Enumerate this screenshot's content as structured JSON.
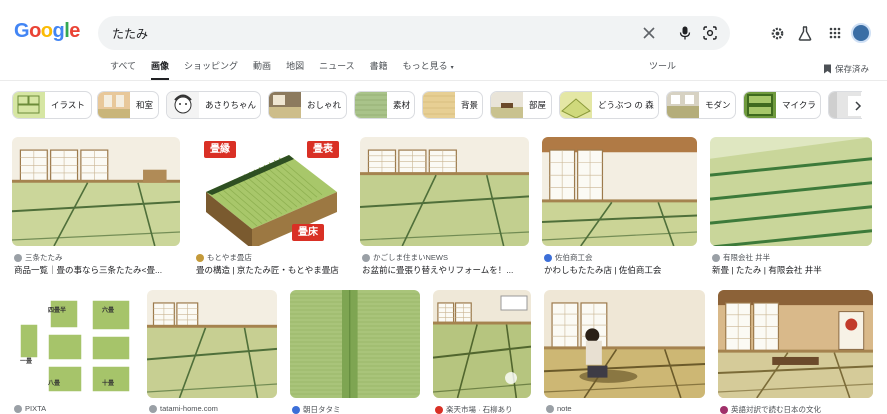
{
  "logo": {
    "text": "Google",
    "letters": [
      {
        "ch": "G",
        "color": "#4285f4"
      },
      {
        "ch": "o",
        "color": "#ea4335"
      },
      {
        "ch": "o",
        "color": "#fbbc05"
      },
      {
        "ch": "g",
        "color": "#4285f4"
      },
      {
        "ch": "l",
        "color": "#34a853"
      },
      {
        "ch": "e",
        "color": "#ea4335"
      }
    ]
  },
  "search": {
    "value": "たたみ"
  },
  "header_icons": [
    "clear-icon",
    "microphone-icon",
    "lens-icon",
    "settings-icon",
    "labs-flask-icon",
    "apps-grid-icon"
  ],
  "tabs": [
    {
      "label": "すべて",
      "active": false
    },
    {
      "label": "画像",
      "active": true
    },
    {
      "label": "ショッピング",
      "active": false
    },
    {
      "label": "動画",
      "active": false
    },
    {
      "label": "地図",
      "active": false
    },
    {
      "label": "ニュース",
      "active": false
    },
    {
      "label": "書籍",
      "active": false
    },
    {
      "label": "もっと見る",
      "active": false
    }
  ],
  "tools_label": "ツール",
  "saved_label": "保存済み",
  "chips": [
    {
      "label": "イラスト"
    },
    {
      "label": "和室"
    },
    {
      "label": "あさりちゃん"
    },
    {
      "label": "おしゃれ"
    },
    {
      "label": "素材"
    },
    {
      "label": "背景"
    },
    {
      "label": "部屋"
    },
    {
      "label": "どうぶつ の 森"
    },
    {
      "label": "モダン"
    },
    {
      "label": "マイクラ"
    },
    {
      "label": ""
    }
  ],
  "results_row1": [
    {
      "source": "三条たたみ",
      "title": "商品一覧｜畳の事なら三条たたみ<畳..."
    },
    {
      "source": "もとやま畳店",
      "title": "畳の構造 | 京たたみ匠・もとやま畳店"
    },
    {
      "source": "かごしま住まいNEWS",
      "title": "お盆前に畳張り替えやリフォームを！..."
    },
    {
      "source": "佐伯商工会",
      "title": "かわしもたたみ店 | 佐伯商工会"
    },
    {
      "source": "有限会社 井半",
      "title": "新畳 | たたみ | 有限会社 井半"
    }
  ],
  "diagram_labels": {
    "heri": "畳縁",
    "omote": "畳表",
    "toko": "畳床"
  },
  "size_chart_labels": [
    "一畳",
    "四畳半",
    "六畳",
    "八畳",
    "十畳"
  ],
  "results_row2": [
    {
      "source": "PIXTA"
    },
    {
      "source": "tatami-home.com"
    },
    {
      "source": "朝日タタミ"
    },
    {
      "source": "楽天市場 · 石柳あり"
    },
    {
      "source": "note"
    },
    {
      "source": "英語対訳で読む日本の文化"
    }
  ],
  "colors": {
    "accent_text": "#202124",
    "muted_text": "#4d5156",
    "search_bg": "#f1f3f4",
    "tatami_green": "#c8d79a",
    "tatami_edge": "#4f6f3a",
    "diagram_red": "#d93025"
  }
}
